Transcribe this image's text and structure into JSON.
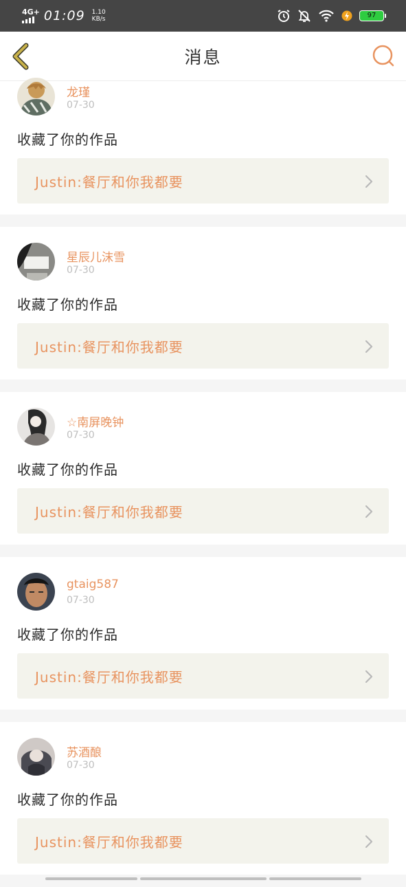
{
  "status_bar": {
    "network": "4G+",
    "time": "01:09",
    "speed_value": "1.10",
    "speed_unit": "KB/s",
    "battery": "97",
    "icons": [
      "alarm-icon",
      "bell-mute-icon",
      "wifi-icon",
      "charging-icon",
      "battery-icon"
    ]
  },
  "header": {
    "title": "消息",
    "back_icon": "chevron-left-icon",
    "search_icon": "search-icon"
  },
  "colors": {
    "accent": "#e8935f",
    "back_icon": "#c9b24a",
    "card_box": "#f3f3ec",
    "date": "#bdbdbd",
    "status_bar": "#454545"
  },
  "feed": [
    {
      "username": "龙瑾",
      "date": "07-30",
      "action": "收藏了你的作品",
      "work": "Justin:餐厅和你我都要"
    },
    {
      "username": "星辰儿沫雪",
      "date": "07-30",
      "action": "收藏了你的作品",
      "work": "Justin:餐厅和你我都要"
    },
    {
      "username": "☆南屏晚钟",
      "date": "07-30",
      "action": "收藏了你的作品",
      "work": "Justin:餐厅和你我都要"
    },
    {
      "username": "gtaig587",
      "date": "07-30",
      "action": "收藏了你的作品",
      "work": "Justin:餐厅和你我都要"
    },
    {
      "username": "苏酒酿",
      "date": "07-30",
      "action": "收藏了你的作品",
      "work": "Justin:餐厅和你我都要"
    }
  ]
}
